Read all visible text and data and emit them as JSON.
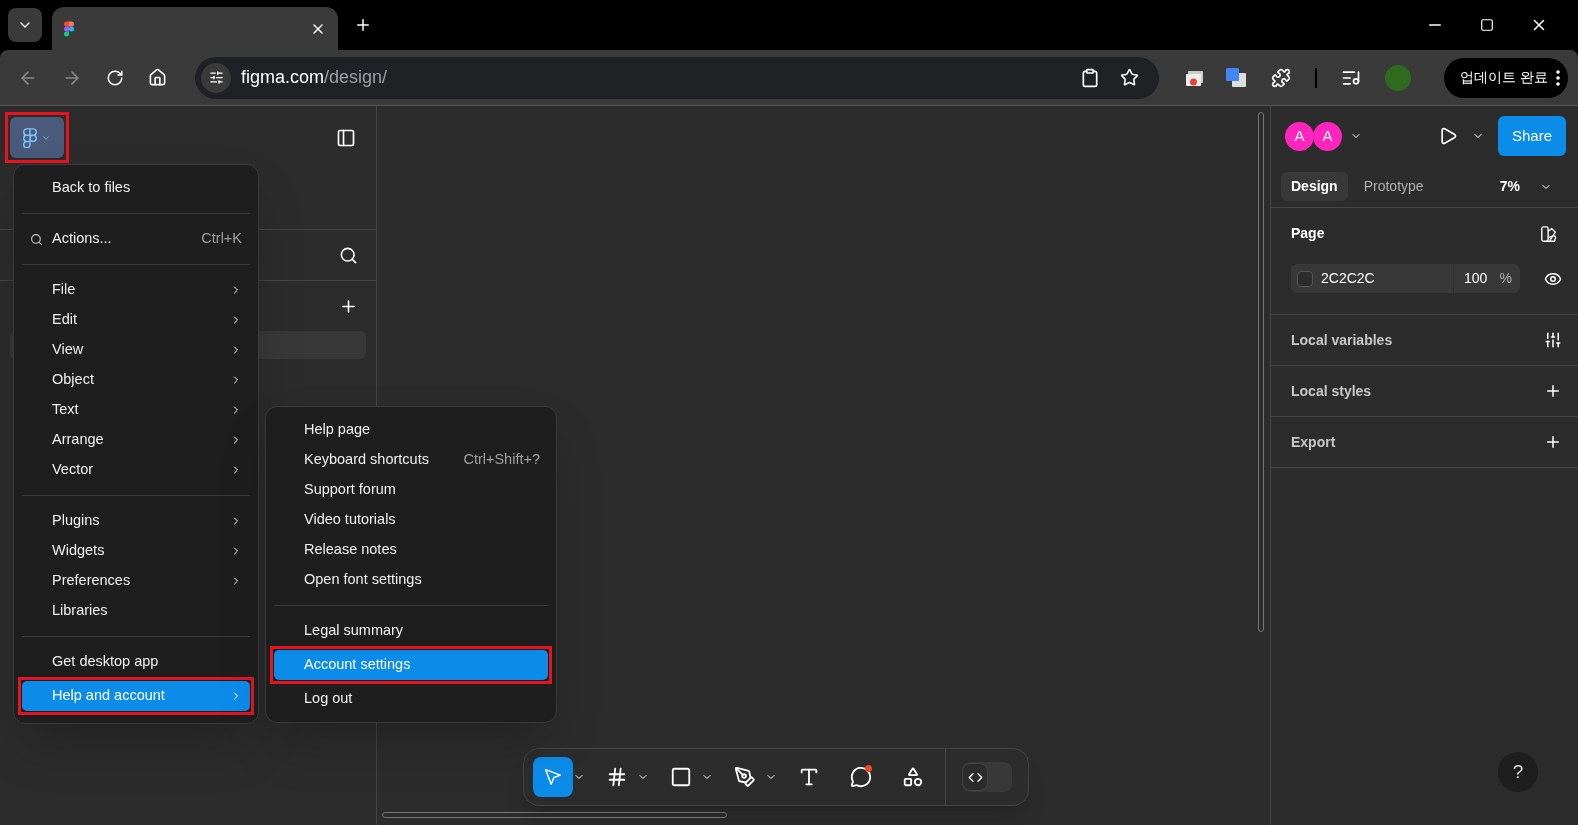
{
  "browser": {
    "url": {
      "host": "figma.com",
      "path": "/design/"
    },
    "update_button": "업데이트 완료"
  },
  "editor": {
    "main_button": {
      "outlined": true
    },
    "main_menu": {
      "groups": [
        [
          {
            "label": "Back to files",
            "kind": "item",
            "submenu": false,
            "selected": false,
            "outlined": false
          }
        ],
        [
          {
            "label": "Actions...",
            "kind": "search",
            "shortcut": "Ctrl+K",
            "submenu": false,
            "selected": false,
            "outlined": false
          }
        ],
        [
          {
            "label": "File",
            "kind": "item",
            "submenu": true,
            "selected": false,
            "outlined": false
          },
          {
            "label": "Edit",
            "kind": "item",
            "submenu": true,
            "selected": false,
            "outlined": false
          },
          {
            "label": "View",
            "kind": "item",
            "submenu": true,
            "selected": false,
            "outlined": false
          },
          {
            "label": "Object",
            "kind": "item",
            "submenu": true,
            "selected": false,
            "outlined": false
          },
          {
            "label": "Text",
            "kind": "item",
            "submenu": true,
            "selected": false,
            "outlined": false
          },
          {
            "label": "Arrange",
            "kind": "item",
            "submenu": true,
            "selected": false,
            "outlined": false
          },
          {
            "label": "Vector",
            "kind": "item",
            "submenu": true,
            "selected": false,
            "outlined": false
          }
        ],
        [
          {
            "label": "Plugins",
            "kind": "item",
            "submenu": true,
            "selected": false,
            "outlined": false
          },
          {
            "label": "Widgets",
            "kind": "item",
            "submenu": true,
            "selected": false,
            "outlined": false
          },
          {
            "label": "Preferences",
            "kind": "item",
            "submenu": true,
            "selected": false,
            "outlined": false
          },
          {
            "label": "Libraries",
            "kind": "item",
            "submenu": false,
            "selected": false,
            "outlined": false
          }
        ],
        [
          {
            "label": "Get desktop app",
            "kind": "item",
            "submenu": false,
            "selected": false,
            "outlined": false
          },
          {
            "label": "Help and account",
            "kind": "item",
            "submenu": true,
            "selected": true,
            "outlined": true
          }
        ]
      ]
    },
    "submenu": {
      "groups": [
        [
          {
            "label": "Help page",
            "kind": "item",
            "submenu": false,
            "selected": false,
            "outlined": false
          },
          {
            "label": "Keyboard shortcuts",
            "kind": "item",
            "shortcut": "Ctrl+Shift+?",
            "submenu": false,
            "selected": false,
            "outlined": false
          },
          {
            "label": "Support forum",
            "kind": "item",
            "submenu": false,
            "selected": false,
            "outlined": false
          },
          {
            "label": "Video tutorials",
            "kind": "item",
            "submenu": false,
            "selected": false,
            "outlined": false
          },
          {
            "label": "Release notes",
            "kind": "item",
            "submenu": false,
            "selected": false,
            "outlined": false
          },
          {
            "label": "Open font settings",
            "kind": "item",
            "submenu": false,
            "selected": false,
            "outlined": false
          }
        ],
        [
          {
            "label": "Legal summary",
            "kind": "item",
            "submenu": false,
            "selected": false,
            "outlined": false
          },
          {
            "label": "Account settings",
            "kind": "item",
            "submenu": false,
            "selected": true,
            "outlined": true
          },
          {
            "label": "Log out",
            "kind": "item",
            "submenu": false,
            "selected": false,
            "outlined": false
          }
        ]
      ]
    },
    "right_panel": {
      "avatars": [
        {
          "initial": "A",
          "color": "#ff24bd"
        },
        {
          "initial": "A",
          "color": "#ff24bd"
        }
      ],
      "share": "Share",
      "tabs": [
        {
          "label": "Design",
          "selected": true
        },
        {
          "label": "Prototype",
          "selected": false
        }
      ],
      "zoom": "7%",
      "page": {
        "title": "Page",
        "fill": {
          "hex": "2C2C2C",
          "opacity": "100",
          "unit": "%"
        }
      },
      "sections": [
        {
          "label": "Local variables",
          "kind": "variables"
        },
        {
          "label": "Local styles",
          "kind": "add"
        },
        {
          "label": "Export",
          "kind": "add"
        }
      ]
    },
    "toolbar": {
      "tools": [
        {
          "kind": "move",
          "selected": true,
          "dropdown": true
        },
        {
          "kind": "frame",
          "selected": false,
          "dropdown": true
        },
        {
          "kind": "shape",
          "selected": false,
          "dropdown": true
        },
        {
          "kind": "pen",
          "selected": false,
          "dropdown": true
        },
        {
          "kind": "text",
          "selected": false,
          "dropdown": false
        },
        {
          "kind": "comment",
          "selected": false,
          "dropdown": false
        },
        {
          "kind": "actions",
          "selected": false,
          "dropdown": false
        }
      ],
      "dev_mode": {
        "on": false
      }
    },
    "help_button": "?"
  }
}
